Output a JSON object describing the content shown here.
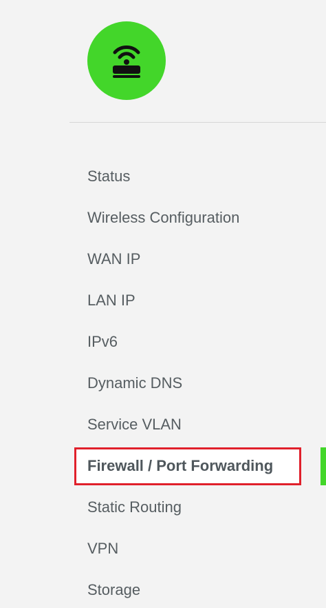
{
  "brand": {
    "logo_icon": "router-wifi-icon",
    "logo_color": "#43d62a"
  },
  "nav": {
    "items": [
      {
        "label": "Status",
        "active": false
      },
      {
        "label": "Wireless Configuration",
        "active": false
      },
      {
        "label": "WAN IP",
        "active": false
      },
      {
        "label": "LAN IP",
        "active": false
      },
      {
        "label": "IPv6",
        "active": false
      },
      {
        "label": "Dynamic DNS",
        "active": false
      },
      {
        "label": "Service VLAN",
        "active": false
      },
      {
        "label": "Firewall / Port Forwarding",
        "active": true
      },
      {
        "label": "Static Routing",
        "active": false
      },
      {
        "label": "VPN",
        "active": false
      },
      {
        "label": "Storage",
        "active": false
      }
    ]
  },
  "colors": {
    "accent_green": "#43d62a",
    "highlight_red": "#e0202b",
    "text": "#565d61",
    "background": "#f3f3f3"
  }
}
